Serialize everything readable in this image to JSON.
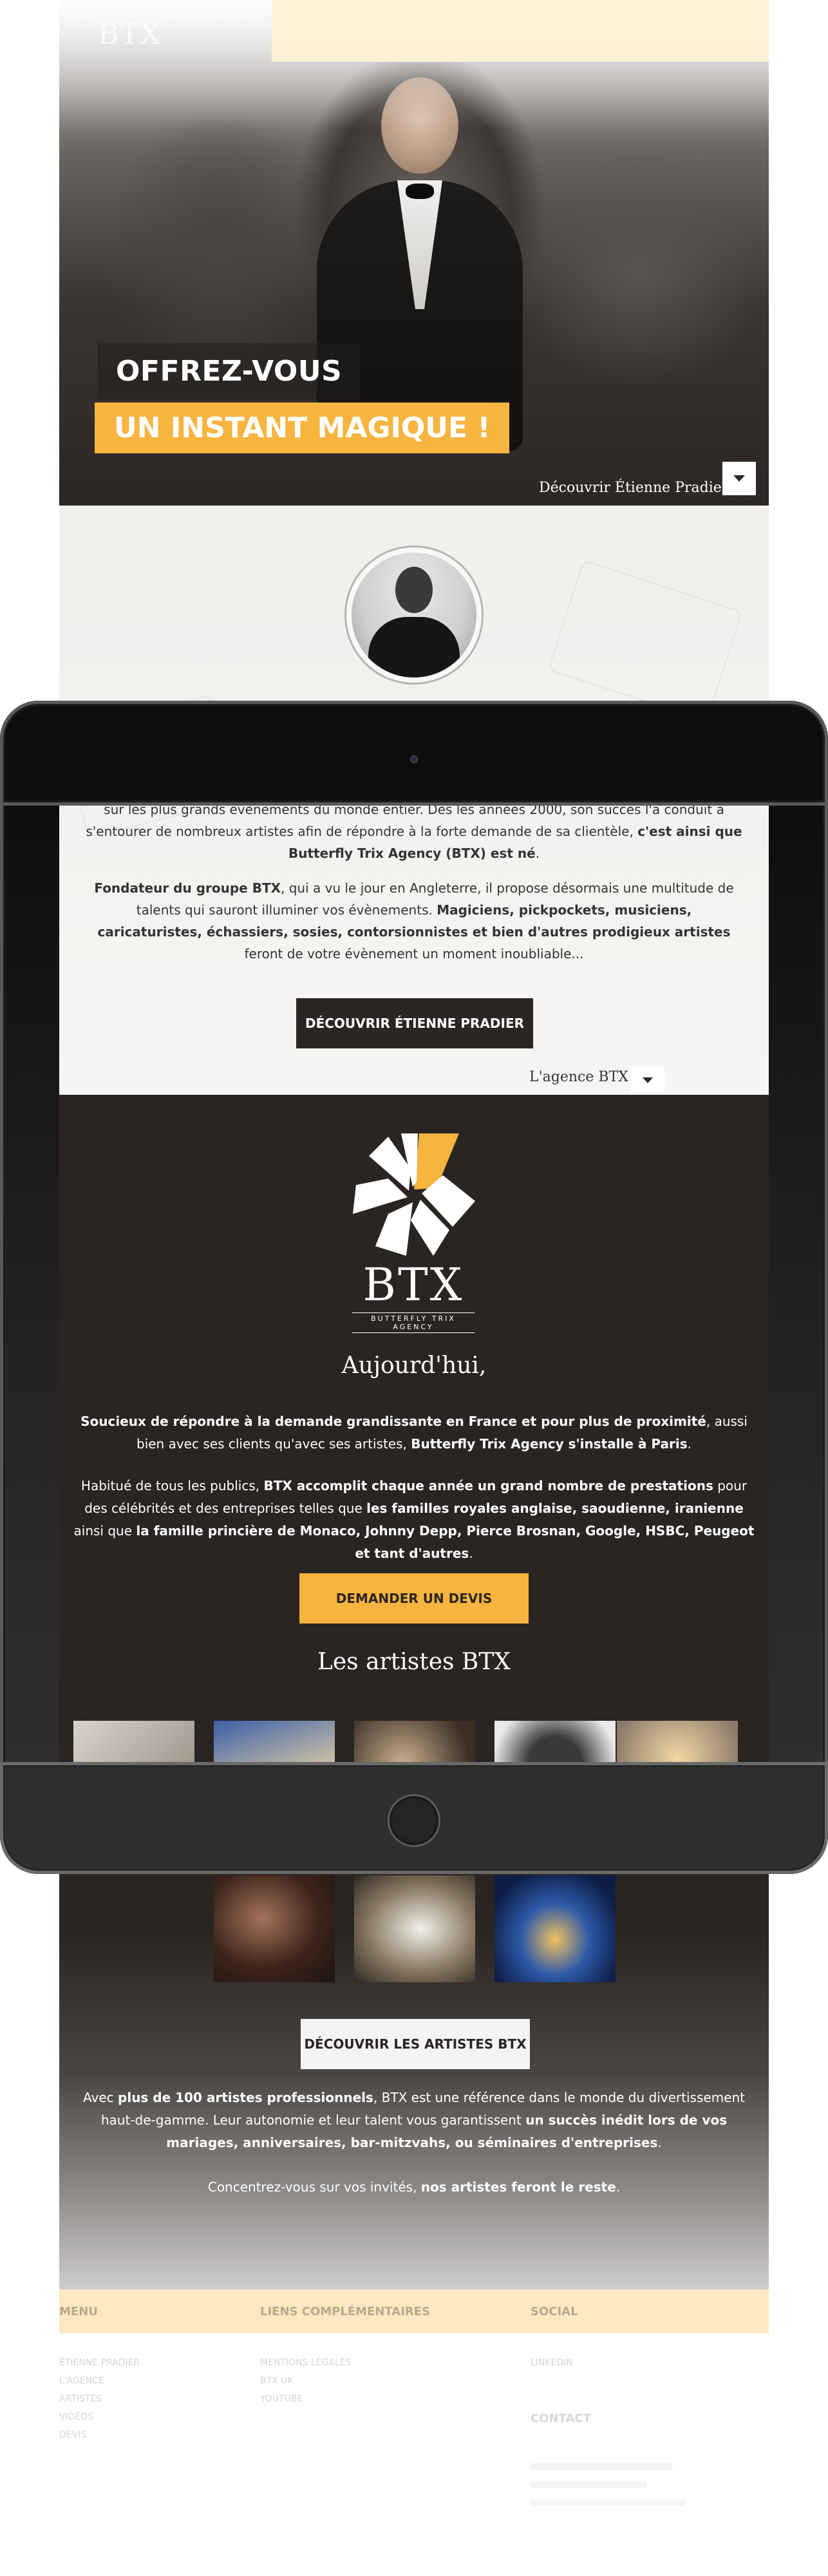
{
  "hero": {
    "logo": "BTX",
    "title": "OFFREZ-VOUS",
    "subtitle": "UN INSTANT MAGIQUE !",
    "link": "Découvrir Étienne Pradier"
  },
  "about": {
    "para1_a": "sur les plus grands évènements du monde entier. Dès les années 2000, son succès l'a conduit à s'entourer de nombreux artistes afin de répondre à la forte demande de sa clientèle,",
    "para1_b": "c'est ainsi que Butterfly Trix Agency (BTX) est né",
    "para2_a": "Fondateur du groupe BTX",
    "para2_b": ", qui a vu le jour en Angleterre, il propose désormais une multitude de talents qui sauront illuminer vos évènements.",
    "para2_c": "Magiciens, pickpockets, musiciens, caricaturistes, échassiers, sosies, contorsionnistes et bien d'autres prodigieux artistes",
    "para2_d": "feront de votre évènement un moment inoubliable...",
    "button": "DÉCOUVRIR ÉTIENNE PRADIER",
    "next_link": "L'agence BTX"
  },
  "btx": {
    "logo_word": "BTX",
    "logo_tag": "BUTTERFLY TRIX AGENCY",
    "heading": "Aujourd'hui,",
    "p1_a": "Soucieux de répondre à la demande grandissante en France et pour plus de proximité",
    "p1_b": ", aussi bien avec ses clients qu'avec ses artistes,",
    "p1_c": "Butterfly Trix Agency s'installe à Paris",
    "p2_a": "Habitué de tous les publics,",
    "p2_b": "BTX accomplit chaque année un grand nombre de prestations",
    "p2_c": "pour des célébrités et des entreprises telles que",
    "p2_d": "les familles royales anglaise, saoudienne, iranienne",
    "p2_e": "ainsi que",
    "p2_f": "la famille princière de Monaco, Johnny Depp, Pierce Brosnan, Google, HSBC, Peugeot et tant d'autres",
    "quote_button": "DEMANDER UN DEVIS",
    "artists_heading": "Les artistes BTX",
    "artists_button": "DÉCOUVRIR LES ARTISTES BTX",
    "p3_a": "Avec",
    "p3_b": "plus de 100 artistes professionnels",
    "p3_c": ", BTX est une référence dans le monde du divertissement haut-de-gamme. Leur autonomie et leur talent vous garantissent",
    "p3_d": "un succès inédit lors de vos mariages, anniversaires, bar-mitzvahs, ou séminaires d'entreprises",
    "p4_a": "Concentrez-vous sur vos invités,",
    "p4_b": "nos artistes feront le reste"
  },
  "footer": {
    "menu_heading": "MENU",
    "menu_items": [
      "ÉTIENNE PRADIER",
      "L'AGENCE",
      "ARTISTES",
      "VIDÉOS",
      "DEVIS"
    ],
    "links_heading": "LIENS COMPLÉMENTAIRES",
    "links_items": [
      "MENTIONS LÉGALES",
      "BTX UK",
      "YOUTUBE"
    ],
    "social_heading": "SOCIAL",
    "social_items": [
      "LINKEDIN"
    ],
    "contact_heading": "CONTACT"
  },
  "colors": {
    "accent": "#f7b43e",
    "dark": "#2a2523",
    "footer_bar": "#fce9c2"
  }
}
